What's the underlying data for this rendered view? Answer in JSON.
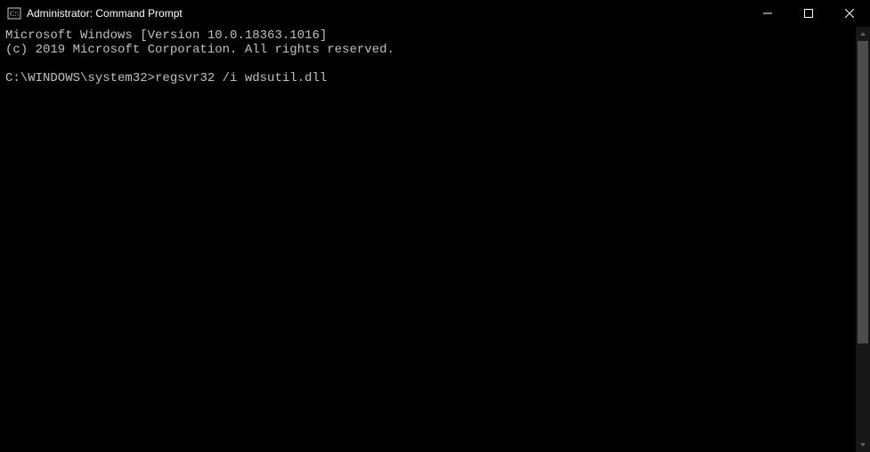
{
  "titlebar": {
    "title": "Administrator: Command Prompt"
  },
  "terminal": {
    "line1": "Microsoft Windows [Version 10.0.18363.1016]",
    "line2": "(c) 2019 Microsoft Corporation. All rights reserved.",
    "blank": "",
    "prompt": "C:\\WINDOWS\\system32>",
    "command": "regsvr32 /i wdsutil.dll"
  }
}
